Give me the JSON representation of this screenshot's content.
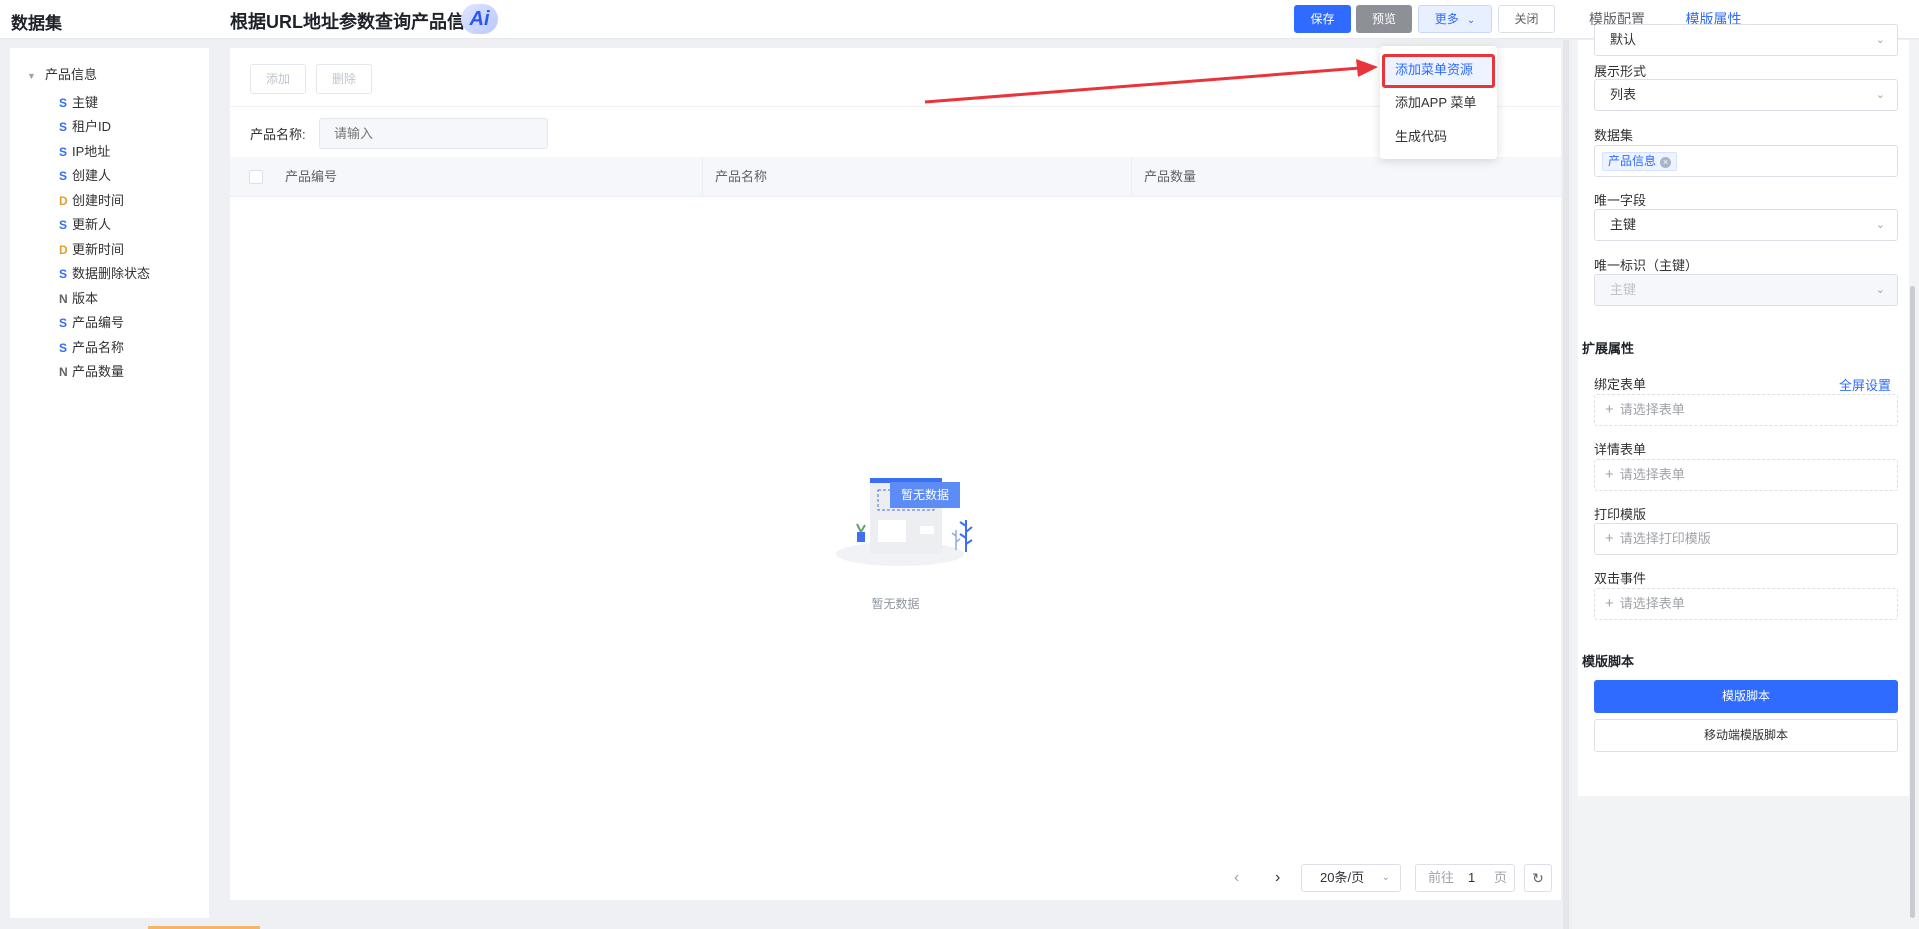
{
  "header": {
    "app_title": "数据集",
    "page_title": "根据URL地址参数查询产品信息",
    "ai_badge": "Ai",
    "buttons": {
      "save": "保存",
      "preview": "预览",
      "more": "更多",
      "close": "关闭"
    },
    "tabs": [
      "模版配置",
      "模版属性"
    ],
    "active_tab": "模版属性"
  },
  "tree": {
    "root": "产品信息",
    "items": [
      {
        "type": "S",
        "label": "主键"
      },
      {
        "type": "S",
        "label": "租户ID"
      },
      {
        "type": "S",
        "label": "IP地址"
      },
      {
        "type": "S",
        "label": "创建人"
      },
      {
        "type": "D",
        "label": "创建时间"
      },
      {
        "type": "S",
        "label": "更新人"
      },
      {
        "type": "D",
        "label": "更新时间"
      },
      {
        "type": "S",
        "label": "数据删除状态"
      },
      {
        "type": "N",
        "label": "版本"
      },
      {
        "type": "S",
        "label": "产品编号"
      },
      {
        "type": "S",
        "label": "产品名称"
      },
      {
        "type": "N",
        "label": "产品数量"
      }
    ]
  },
  "grid": {
    "add_label": "添加",
    "delete_label": "删除",
    "filter_label": "产品名称:",
    "filter_placeholder": "请输入",
    "columns": [
      "产品编号",
      "产品名称",
      "产品数量"
    ],
    "empty_badge": "暂无数据",
    "empty_text": "暂无数据"
  },
  "pagination": {
    "page_size": "20条/页",
    "goto_prefix": "前往",
    "page": "1",
    "goto_suffix": "页"
  },
  "more_menu": {
    "items": [
      "添加菜单资源",
      "添加APP 菜单",
      "生成代码"
    ],
    "highlighted": "添加菜单资源"
  },
  "properties": {
    "top_select_partial": "默认",
    "display_label": "展示形式",
    "display_value": "列表",
    "dataset_label": "数据集",
    "dataset_tag": "产品信息",
    "unique_field_label": "唯一字段",
    "unique_field_value": "主键",
    "unique_id_label": "唯一标识（主键）",
    "unique_id_value": "主键",
    "ext_title": "扩展属性",
    "bind_form_label": "绑定表单",
    "fullscreen_link": "全屏设置",
    "bind_form_placeholder": "请选择表单",
    "detail_form_label": "详情表单",
    "detail_form_placeholder": "请选择表单",
    "print_label": "打印模版",
    "print_placeholder": "请选择打印模版",
    "dblclick_label": "双击事件",
    "dblclick_placeholder": "请选择表单",
    "script_title": "模版脚本",
    "script_button": "模版脚本",
    "mobile_script_button": "移动端模版脚本"
  },
  "colors": {
    "primary": "#2f6bff",
    "annotation": "#e8343a"
  }
}
